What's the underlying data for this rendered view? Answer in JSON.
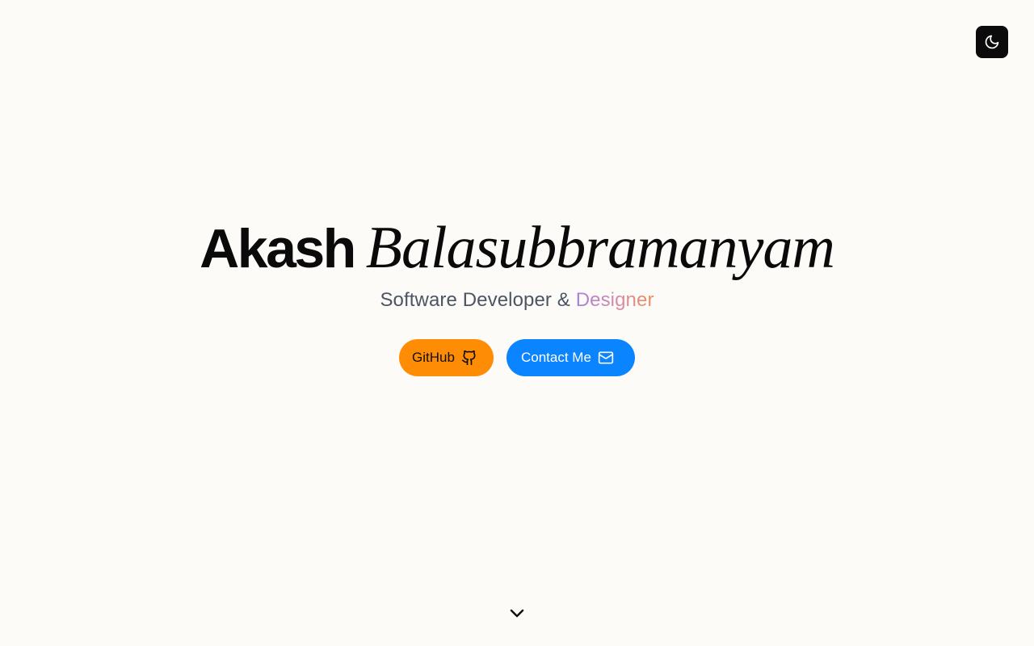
{
  "theme_toggle": {
    "icon": "moon-icon"
  },
  "hero": {
    "first_name": "Akash",
    "last_name": "Balasubbramanyam",
    "subtitle_prefix": "Software Developer &",
    "subtitle_accent": "Designer"
  },
  "actions": {
    "github_label": "GitHub",
    "github_icon": "github-icon",
    "contact_label": "Contact Me",
    "contact_icon": "mail-icon"
  },
  "scroll_hint": {
    "icon": "chevron-down-icon"
  },
  "colors": {
    "background": "#fcfbf8",
    "github_button": "#ff8c05",
    "contact_button": "#0a84ff",
    "toggle": "#0b0b0b",
    "accent_gradient": [
      "#a880de",
      "#d98aa6",
      "#ee8f5a"
    ]
  }
}
